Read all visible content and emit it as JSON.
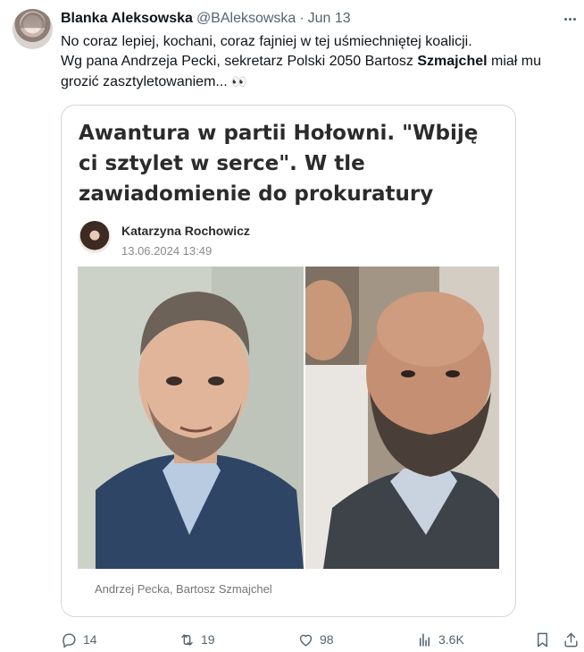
{
  "tweet": {
    "display_name": "Blanka Aleksowska",
    "handle": "@BAleksowska",
    "separator": "·",
    "date": "Jun 13",
    "text": {
      "line1": "No coraz lepiej, kochani, coraz fajniej w tej uśmiechniętej koalicji.",
      "line2_before": "Wg pana Andrzeja Pecki, sekretarz Polski 2050 Bartosz ",
      "line2_bold": "Szmajchel",
      "line2_after": " miał mu",
      "line3": "grozić zasztyletowaniem...",
      "emoji": "👀"
    }
  },
  "card": {
    "title": "Awantura w partii Hołowni. \"Wbiję ci sztylet w serce\". W tle zawiadomienie do prokuratury",
    "author_name": "Katarzyna Rochowicz",
    "published": "13.06.2024 13:49",
    "caption": "Andrzej Pecka, Bartosz Szmajchel"
  },
  "actions": {
    "replies": "14",
    "reposts": "19",
    "likes": "98",
    "views": "3.6K"
  },
  "icons": {
    "more": "more-horizontal-icon",
    "reply": "reply-icon",
    "repost": "repost-icon",
    "like": "heart-icon",
    "views": "views-bar-chart-icon",
    "bookmark": "bookmark-icon",
    "share": "share-icon"
  },
  "colors": {
    "text_primary": "#0f1419",
    "text_secondary": "#536471",
    "border": "#cfd9de"
  }
}
